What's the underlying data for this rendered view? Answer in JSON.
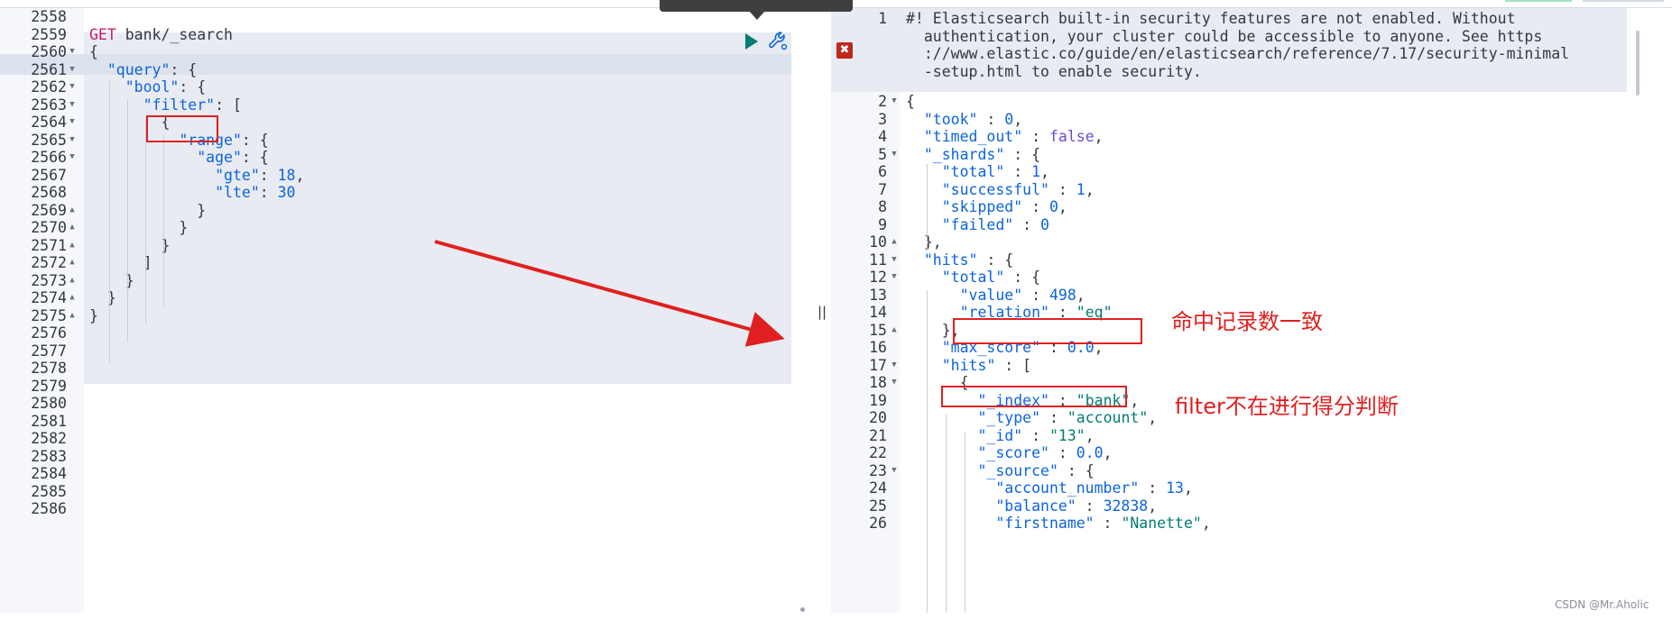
{
  "request": {
    "method": "GET",
    "path": "bank/_search",
    "lines": [
      {
        "n": "2558",
        "fold": "",
        "parts": []
      },
      {
        "n": "2559",
        "fold": "",
        "parts": [
          [
            "kw-get",
            "GET"
          ],
          [
            "punc",
            " bank/_search"
          ]
        ]
      },
      {
        "n": "2560",
        "fold": "▼",
        "parts": [
          [
            "punc",
            "{"
          ]
        ]
      },
      {
        "n": "2561",
        "fold": "▼",
        "parts": [
          [
            "punc",
            "  "
          ],
          [
            "key",
            "\"query\""
          ],
          [
            "punc",
            ": {"
          ]
        ]
      },
      {
        "n": "2562",
        "fold": "▼",
        "parts": [
          [
            "punc",
            "    "
          ],
          [
            "key",
            "\"bool\""
          ],
          [
            "punc",
            ": {"
          ]
        ]
      },
      {
        "n": "2563",
        "fold": "▼",
        "parts": [
          [
            "punc",
            "      "
          ],
          [
            "key",
            "\"filter\""
          ],
          [
            "punc",
            ": ["
          ]
        ]
      },
      {
        "n": "2564",
        "fold": "▼",
        "parts": [
          [
            "punc",
            "        {"
          ]
        ]
      },
      {
        "n": "2565",
        "fold": "▼",
        "parts": [
          [
            "punc",
            "          "
          ],
          [
            "key",
            "\"range\""
          ],
          [
            "punc",
            ": {"
          ]
        ]
      },
      {
        "n": "2566",
        "fold": "▼",
        "parts": [
          [
            "punc",
            "            "
          ],
          [
            "key",
            "\"age\""
          ],
          [
            "punc",
            ": {"
          ]
        ]
      },
      {
        "n": "2567",
        "fold": "",
        "parts": [
          [
            "punc",
            "              "
          ],
          [
            "key",
            "\"gte\""
          ],
          [
            "punc",
            ": "
          ],
          [
            "num",
            "18"
          ],
          [
            "punc",
            ","
          ]
        ]
      },
      {
        "n": "2568",
        "fold": "",
        "parts": [
          [
            "punc",
            "              "
          ],
          [
            "key",
            "\"lte\""
          ],
          [
            "punc",
            ": "
          ],
          [
            "num",
            "30"
          ]
        ]
      },
      {
        "n": "2569",
        "fold": "▲",
        "parts": [
          [
            "punc",
            "            }"
          ]
        ]
      },
      {
        "n": "2570",
        "fold": "▲",
        "parts": [
          [
            "punc",
            "          }"
          ]
        ]
      },
      {
        "n": "2571",
        "fold": "▲",
        "parts": [
          [
            "punc",
            "        }"
          ]
        ]
      },
      {
        "n": "2572",
        "fold": "▲",
        "parts": [
          [
            "punc",
            "      ]"
          ]
        ]
      },
      {
        "n": "2573",
        "fold": "▲",
        "parts": [
          [
            "punc",
            "    }"
          ]
        ]
      },
      {
        "n": "2574",
        "fold": "▲",
        "parts": [
          [
            "punc",
            "  }"
          ]
        ]
      },
      {
        "n": "2575",
        "fold": "▲",
        "parts": [
          [
            "punc",
            "}"
          ]
        ]
      },
      {
        "n": "2576",
        "fold": "",
        "parts": []
      },
      {
        "n": "2577",
        "fold": "",
        "parts": []
      },
      {
        "n": "2578",
        "fold": "",
        "parts": []
      },
      {
        "n": "2579",
        "fold": "",
        "parts": []
      },
      {
        "n": "2580",
        "fold": "",
        "parts": []
      },
      {
        "n": "2581",
        "fold": "",
        "parts": []
      },
      {
        "n": "2582",
        "fold": "",
        "parts": []
      },
      {
        "n": "2583",
        "fold": "",
        "parts": []
      },
      {
        "n": "2584",
        "fold": "",
        "parts": []
      },
      {
        "n": "2585",
        "fold": "",
        "parts": []
      },
      {
        "n": "2586",
        "fold": "",
        "parts": []
      }
    ]
  },
  "response": {
    "warning": [
      "#! Elasticsearch built-in security features are not enabled. Without",
      "  authentication, your cluster could be accessible to anyone. See https",
      "  ://www.elastic.co/guide/en/elasticsearch/reference/7.17/security-minimal",
      "  -setup.html to enable security."
    ],
    "lines": [
      {
        "n": "2",
        "fold": "▼",
        "parts": [
          [
            "punc",
            "{"
          ]
        ]
      },
      {
        "n": "3",
        "fold": "",
        "parts": [
          [
            "punc",
            "  "
          ],
          [
            "key",
            "\"took\""
          ],
          [
            "punc",
            " : "
          ],
          [
            "num",
            "0"
          ],
          [
            "punc",
            ","
          ]
        ]
      },
      {
        "n": "4",
        "fold": "",
        "parts": [
          [
            "punc",
            "  "
          ],
          [
            "key",
            "\"timed_out\""
          ],
          [
            "punc",
            " : "
          ],
          [
            "bool",
            "false"
          ],
          [
            "punc",
            ","
          ]
        ]
      },
      {
        "n": "5",
        "fold": "▼",
        "parts": [
          [
            "punc",
            "  "
          ],
          [
            "key",
            "\"_shards\""
          ],
          [
            "punc",
            " : {"
          ]
        ]
      },
      {
        "n": "6",
        "fold": "",
        "parts": [
          [
            "punc",
            "    "
          ],
          [
            "key",
            "\"total\""
          ],
          [
            "punc",
            " : "
          ],
          [
            "num",
            "1"
          ],
          [
            "punc",
            ","
          ]
        ]
      },
      {
        "n": "7",
        "fold": "",
        "parts": [
          [
            "punc",
            "    "
          ],
          [
            "key",
            "\"successful\""
          ],
          [
            "punc",
            " : "
          ],
          [
            "num",
            "1"
          ],
          [
            "punc",
            ","
          ]
        ]
      },
      {
        "n": "8",
        "fold": "",
        "parts": [
          [
            "punc",
            "    "
          ],
          [
            "key",
            "\"skipped\""
          ],
          [
            "punc",
            " : "
          ],
          [
            "num",
            "0"
          ],
          [
            "punc",
            ","
          ]
        ]
      },
      {
        "n": "9",
        "fold": "",
        "parts": [
          [
            "punc",
            "    "
          ],
          [
            "key",
            "\"failed\""
          ],
          [
            "punc",
            " : "
          ],
          [
            "num",
            "0"
          ]
        ]
      },
      {
        "n": "10",
        "fold": "▲",
        "parts": [
          [
            "punc",
            "  },"
          ]
        ]
      },
      {
        "n": "11",
        "fold": "▼",
        "parts": [
          [
            "punc",
            "  "
          ],
          [
            "key",
            "\"hits\""
          ],
          [
            "punc",
            " : {"
          ]
        ]
      },
      {
        "n": "12",
        "fold": "▼",
        "parts": [
          [
            "punc",
            "    "
          ],
          [
            "key",
            "\"total\""
          ],
          [
            "punc",
            " : {"
          ]
        ]
      },
      {
        "n": "13",
        "fold": "",
        "parts": [
          [
            "punc",
            "      "
          ],
          [
            "key",
            "\"value\""
          ],
          [
            "punc",
            " : "
          ],
          [
            "num",
            "498"
          ],
          [
            "punc",
            ","
          ]
        ]
      },
      {
        "n": "14",
        "fold": "",
        "parts": [
          [
            "punc",
            "      "
          ],
          [
            "key",
            "\"relation\""
          ],
          [
            "punc",
            " : "
          ],
          [
            "str",
            "\"eq\""
          ]
        ]
      },
      {
        "n": "15",
        "fold": "▲",
        "parts": [
          [
            "punc",
            "    },"
          ]
        ]
      },
      {
        "n": "16",
        "fold": "",
        "parts": [
          [
            "punc",
            "    "
          ],
          [
            "key",
            "\"max_score\""
          ],
          [
            "punc",
            " : "
          ],
          [
            "num",
            "0.0"
          ],
          [
            "punc",
            ","
          ]
        ]
      },
      {
        "n": "17",
        "fold": "▼",
        "parts": [
          [
            "punc",
            "    "
          ],
          [
            "key",
            "\"hits\""
          ],
          [
            "punc",
            " : ["
          ]
        ]
      },
      {
        "n": "18",
        "fold": "▼",
        "parts": [
          [
            "punc",
            "      {"
          ]
        ]
      },
      {
        "n": "19",
        "fold": "",
        "parts": [
          [
            "punc",
            "        "
          ],
          [
            "key",
            "\"_index\""
          ],
          [
            "punc",
            " : "
          ],
          [
            "str",
            "\"bank\""
          ],
          [
            "punc",
            ","
          ]
        ]
      },
      {
        "n": "20",
        "fold": "",
        "parts": [
          [
            "punc",
            "        "
          ],
          [
            "key",
            "\"_type\""
          ],
          [
            "punc",
            " : "
          ],
          [
            "str",
            "\"account\""
          ],
          [
            "punc",
            ","
          ]
        ]
      },
      {
        "n": "21",
        "fold": "",
        "parts": [
          [
            "punc",
            "        "
          ],
          [
            "key",
            "\"_id\""
          ],
          [
            "punc",
            " : "
          ],
          [
            "str",
            "\"13\""
          ],
          [
            "punc",
            ","
          ]
        ]
      },
      {
        "n": "22",
        "fold": "",
        "parts": [
          [
            "punc",
            "        "
          ],
          [
            "key",
            "\"_score\""
          ],
          [
            "punc",
            " : "
          ],
          [
            "num",
            "0.0"
          ],
          [
            "punc",
            ","
          ]
        ]
      },
      {
        "n": "23",
        "fold": "▼",
        "parts": [
          [
            "punc",
            "        "
          ],
          [
            "key",
            "\"_source\""
          ],
          [
            "punc",
            " : {"
          ]
        ]
      },
      {
        "n": "24",
        "fold": "",
        "parts": [
          [
            "punc",
            "          "
          ],
          [
            "key",
            "\"account_number\""
          ],
          [
            "punc",
            " : "
          ],
          [
            "num",
            "13"
          ],
          [
            "punc",
            ","
          ]
        ]
      },
      {
        "n": "25",
        "fold": "",
        "parts": [
          [
            "punc",
            "          "
          ],
          [
            "key",
            "\"balance\""
          ],
          [
            "punc",
            " : "
          ],
          [
            "num",
            "32838"
          ],
          [
            "punc",
            ","
          ]
        ]
      },
      {
        "n": "26",
        "fold": "",
        "parts": [
          [
            "punc",
            "          "
          ],
          [
            "key",
            "\"firstname\""
          ],
          [
            "punc",
            " : "
          ],
          [
            "str",
            "\"Nanette\""
          ],
          [
            "punc",
            ","
          ]
        ]
      }
    ],
    "warning_line_number": "1"
  },
  "annotations": {
    "hits_match": "命中记录数一致",
    "filter_no_score": "filter不在进行得分判断"
  },
  "divider_glyph": "||",
  "error_glyph": "✖",
  "watermark": "CSDN @Mr.Aholic",
  "colors": {
    "annotation": "#e02020",
    "run": "#017d73",
    "error": "#bd271e"
  }
}
